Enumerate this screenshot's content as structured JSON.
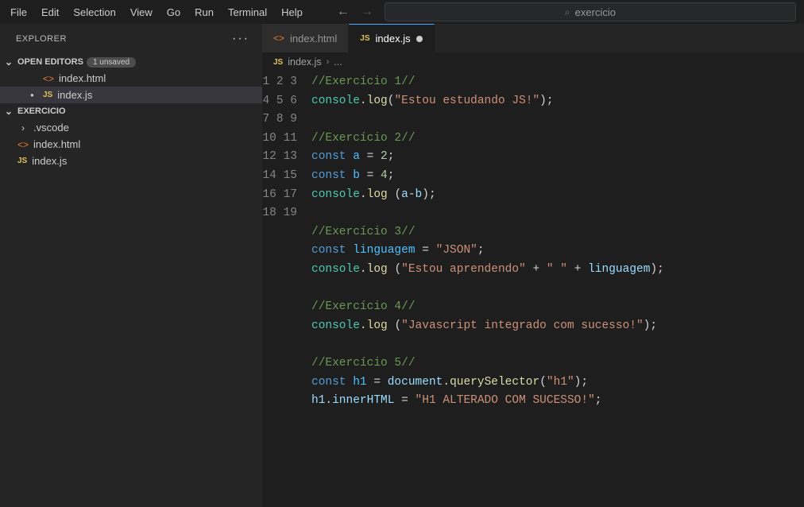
{
  "menu": {
    "file": "File",
    "edit": "Edit",
    "selection": "Selection",
    "view": "View",
    "go": "Go",
    "run": "Run",
    "terminal": "Terminal",
    "help": "Help"
  },
  "search": {
    "text": "exercicio"
  },
  "explorer": {
    "title": "EXPLORER",
    "openEditors": {
      "label": "OPEN EDITORS",
      "badge": "1 unsaved",
      "items": [
        {
          "icon": "html",
          "name": "index.html",
          "modified": false
        },
        {
          "icon": "js",
          "name": "index.js",
          "modified": true,
          "active": true
        }
      ]
    },
    "project": {
      "label": "EXERCICIO",
      "items": [
        {
          "type": "folder",
          "name": ".vscode"
        },
        {
          "type": "file",
          "icon": "html",
          "name": "index.html"
        },
        {
          "type": "file",
          "icon": "js",
          "name": "index.js"
        }
      ]
    }
  },
  "tabs": [
    {
      "icon": "html",
      "name": "index.html",
      "active": false
    },
    {
      "icon": "js",
      "name": "index.js",
      "active": true,
      "modified": true
    }
  ],
  "breadcrumb": {
    "icon": "js",
    "file": "index.js",
    "rest": "..."
  },
  "code": {
    "lines": [
      {
        "n": 1,
        "seg": [
          [
            "cmt",
            "//Exercício 1//"
          ]
        ]
      },
      {
        "n": 2,
        "seg": [
          [
            "obj",
            "console"
          ],
          [
            "op",
            "."
          ],
          [
            "fn",
            "log"
          ],
          [
            "op",
            "("
          ],
          [
            "str",
            "\"Estou estudando JS!\""
          ],
          [
            "op",
            ");"
          ]
        ]
      },
      {
        "n": 3,
        "seg": []
      },
      {
        "n": 4,
        "seg": [
          [
            "cmt",
            "//Exercício 2//"
          ]
        ]
      },
      {
        "n": 5,
        "seg": [
          [
            "kw",
            "const "
          ],
          [
            "const",
            "a"
          ],
          [
            "op",
            " = "
          ],
          [
            "num",
            "2"
          ],
          [
            "op",
            ";"
          ]
        ]
      },
      {
        "n": 6,
        "seg": [
          [
            "kw",
            "const "
          ],
          [
            "const",
            "b"
          ],
          [
            "op",
            " = "
          ],
          [
            "num",
            "4"
          ],
          [
            "op",
            ";"
          ]
        ]
      },
      {
        "n": 7,
        "seg": [
          [
            "obj",
            "console"
          ],
          [
            "op",
            "."
          ],
          [
            "fn",
            "log "
          ],
          [
            "op",
            "("
          ],
          [
            "var",
            "a"
          ],
          [
            "op",
            "-"
          ],
          [
            "var",
            "b"
          ],
          [
            "op",
            ");"
          ]
        ]
      },
      {
        "n": 8,
        "seg": []
      },
      {
        "n": 9,
        "seg": [
          [
            "cmt",
            "//Exercício 3//"
          ]
        ]
      },
      {
        "n": 10,
        "seg": [
          [
            "kw",
            "const "
          ],
          [
            "const",
            "linguagem"
          ],
          [
            "op",
            " = "
          ],
          [
            "str",
            "\"JSON\""
          ],
          [
            "op",
            ";"
          ]
        ]
      },
      {
        "n": 11,
        "seg": [
          [
            "obj",
            "console"
          ],
          [
            "op",
            "."
          ],
          [
            "fn",
            "log "
          ],
          [
            "op",
            "("
          ],
          [
            "str",
            "\"Estou aprendendo\""
          ],
          [
            "op",
            " + "
          ],
          [
            "str",
            "\" \""
          ],
          [
            "op",
            " + "
          ],
          [
            "var",
            "linguagem"
          ],
          [
            "op",
            ");"
          ]
        ]
      },
      {
        "n": 12,
        "seg": []
      },
      {
        "n": 13,
        "seg": [
          [
            "cmt",
            "//Exercício 4//"
          ]
        ]
      },
      {
        "n": 14,
        "seg": [
          [
            "obj",
            "console"
          ],
          [
            "op",
            "."
          ],
          [
            "fn",
            "log "
          ],
          [
            "op",
            "("
          ],
          [
            "str",
            "\"Javascript integrado com sucesso!\""
          ],
          [
            "op",
            ");"
          ]
        ]
      },
      {
        "n": 15,
        "seg": []
      },
      {
        "n": 16,
        "seg": [
          [
            "cmt",
            "//Exercício 5//"
          ]
        ]
      },
      {
        "n": 17,
        "seg": [
          [
            "kw",
            "const "
          ],
          [
            "const",
            "h1"
          ],
          [
            "op",
            " = "
          ],
          [
            "var",
            "document"
          ],
          [
            "op",
            "."
          ],
          [
            "fn",
            "querySelector"
          ],
          [
            "op",
            "("
          ],
          [
            "str",
            "\"h1\""
          ],
          [
            "op",
            ");"
          ]
        ]
      },
      {
        "n": 18,
        "seg": [
          [
            "var",
            "h1"
          ],
          [
            "op",
            "."
          ],
          [
            "var",
            "innerHTML"
          ],
          [
            "op",
            " = "
          ],
          [
            "str",
            "\"H1 ALTERADO COM SUCESSO!\""
          ],
          [
            "op",
            ";"
          ]
        ]
      },
      {
        "n": 19,
        "seg": []
      }
    ]
  }
}
